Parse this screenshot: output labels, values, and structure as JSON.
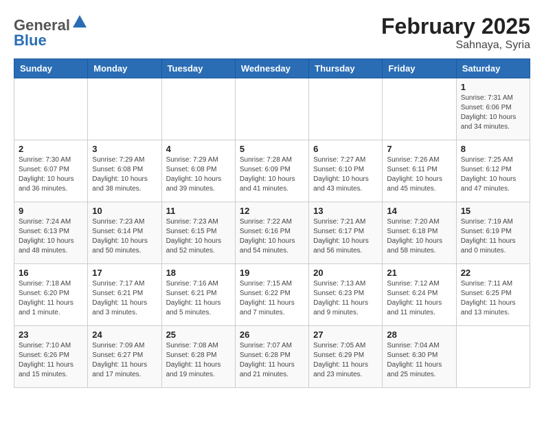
{
  "header": {
    "logo_general": "General",
    "logo_blue": "Blue",
    "title": "February 2025",
    "subtitle": "Sahnaya, Syria"
  },
  "weekdays": [
    "Sunday",
    "Monday",
    "Tuesday",
    "Wednesday",
    "Thursday",
    "Friday",
    "Saturday"
  ],
  "weeks": [
    [
      {
        "day": "",
        "info": ""
      },
      {
        "day": "",
        "info": ""
      },
      {
        "day": "",
        "info": ""
      },
      {
        "day": "",
        "info": ""
      },
      {
        "day": "",
        "info": ""
      },
      {
        "day": "",
        "info": ""
      },
      {
        "day": "1",
        "info": "Sunrise: 7:31 AM\nSunset: 6:06 PM\nDaylight: 10 hours\nand 34 minutes."
      }
    ],
    [
      {
        "day": "2",
        "info": "Sunrise: 7:30 AM\nSunset: 6:07 PM\nDaylight: 10 hours\nand 36 minutes."
      },
      {
        "day": "3",
        "info": "Sunrise: 7:29 AM\nSunset: 6:08 PM\nDaylight: 10 hours\nand 38 minutes."
      },
      {
        "day": "4",
        "info": "Sunrise: 7:29 AM\nSunset: 6:08 PM\nDaylight: 10 hours\nand 39 minutes."
      },
      {
        "day": "5",
        "info": "Sunrise: 7:28 AM\nSunset: 6:09 PM\nDaylight: 10 hours\nand 41 minutes."
      },
      {
        "day": "6",
        "info": "Sunrise: 7:27 AM\nSunset: 6:10 PM\nDaylight: 10 hours\nand 43 minutes."
      },
      {
        "day": "7",
        "info": "Sunrise: 7:26 AM\nSunset: 6:11 PM\nDaylight: 10 hours\nand 45 minutes."
      },
      {
        "day": "8",
        "info": "Sunrise: 7:25 AM\nSunset: 6:12 PM\nDaylight: 10 hours\nand 47 minutes."
      }
    ],
    [
      {
        "day": "9",
        "info": "Sunrise: 7:24 AM\nSunset: 6:13 PM\nDaylight: 10 hours\nand 48 minutes."
      },
      {
        "day": "10",
        "info": "Sunrise: 7:23 AM\nSunset: 6:14 PM\nDaylight: 10 hours\nand 50 minutes."
      },
      {
        "day": "11",
        "info": "Sunrise: 7:23 AM\nSunset: 6:15 PM\nDaylight: 10 hours\nand 52 minutes."
      },
      {
        "day": "12",
        "info": "Sunrise: 7:22 AM\nSunset: 6:16 PM\nDaylight: 10 hours\nand 54 minutes."
      },
      {
        "day": "13",
        "info": "Sunrise: 7:21 AM\nSunset: 6:17 PM\nDaylight: 10 hours\nand 56 minutes."
      },
      {
        "day": "14",
        "info": "Sunrise: 7:20 AM\nSunset: 6:18 PM\nDaylight: 10 hours\nand 58 minutes."
      },
      {
        "day": "15",
        "info": "Sunrise: 7:19 AM\nSunset: 6:19 PM\nDaylight: 11 hours\nand 0 minutes."
      }
    ],
    [
      {
        "day": "16",
        "info": "Sunrise: 7:18 AM\nSunset: 6:20 PM\nDaylight: 11 hours\nand 1 minute."
      },
      {
        "day": "17",
        "info": "Sunrise: 7:17 AM\nSunset: 6:21 PM\nDaylight: 11 hours\nand 3 minutes."
      },
      {
        "day": "18",
        "info": "Sunrise: 7:16 AM\nSunset: 6:21 PM\nDaylight: 11 hours\nand 5 minutes."
      },
      {
        "day": "19",
        "info": "Sunrise: 7:15 AM\nSunset: 6:22 PM\nDaylight: 11 hours\nand 7 minutes."
      },
      {
        "day": "20",
        "info": "Sunrise: 7:13 AM\nSunset: 6:23 PM\nDaylight: 11 hours\nand 9 minutes."
      },
      {
        "day": "21",
        "info": "Sunrise: 7:12 AM\nSunset: 6:24 PM\nDaylight: 11 hours\nand 11 minutes."
      },
      {
        "day": "22",
        "info": "Sunrise: 7:11 AM\nSunset: 6:25 PM\nDaylight: 11 hours\nand 13 minutes."
      }
    ],
    [
      {
        "day": "23",
        "info": "Sunrise: 7:10 AM\nSunset: 6:26 PM\nDaylight: 11 hours\nand 15 minutes."
      },
      {
        "day": "24",
        "info": "Sunrise: 7:09 AM\nSunset: 6:27 PM\nDaylight: 11 hours\nand 17 minutes."
      },
      {
        "day": "25",
        "info": "Sunrise: 7:08 AM\nSunset: 6:28 PM\nDaylight: 11 hours\nand 19 minutes."
      },
      {
        "day": "26",
        "info": "Sunrise: 7:07 AM\nSunset: 6:28 PM\nDaylight: 11 hours\nand 21 minutes."
      },
      {
        "day": "27",
        "info": "Sunrise: 7:05 AM\nSunset: 6:29 PM\nDaylight: 11 hours\nand 23 minutes."
      },
      {
        "day": "28",
        "info": "Sunrise: 7:04 AM\nSunset: 6:30 PM\nDaylight: 11 hours\nand 25 minutes."
      },
      {
        "day": "",
        "info": ""
      }
    ]
  ]
}
